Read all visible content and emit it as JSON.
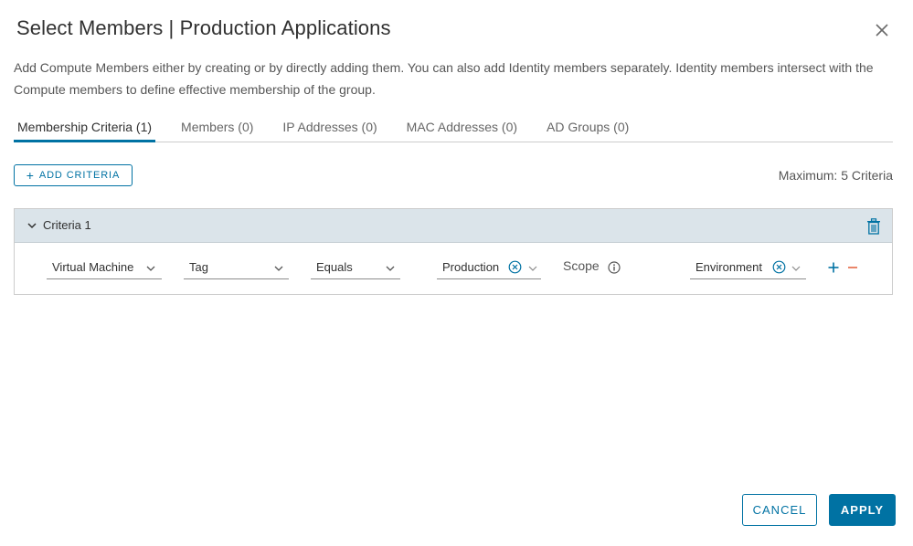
{
  "dialog": {
    "title": "Select Members | Production Applications",
    "description": "Add Compute Members either by creating or by directly adding them. You can also add Identity members separately. Identity members intersect with the Compute members to define effective membership of the group."
  },
  "tabs": [
    {
      "label": "Membership Criteria (1)",
      "active": true
    },
    {
      "label": "Members (0)",
      "active": false
    },
    {
      "label": "IP Addresses (0)",
      "active": false
    },
    {
      "label": "MAC Addresses (0)",
      "active": false
    },
    {
      "label": "AD Groups (0)",
      "active": false
    }
  ],
  "toolbar": {
    "add_criteria_label": "ADD CRITERIA",
    "max_text": "Maximum: 5 Criteria"
  },
  "criteria": {
    "title": "Criteria 1",
    "row": {
      "member_type": "Virtual Machine",
      "property": "Tag",
      "operator": "Equals",
      "tag_value": "Production",
      "scope_label": "Scope",
      "scope_value": "Environment"
    }
  },
  "footer": {
    "cancel_label": "CANCEL",
    "apply_label": "APPLY"
  },
  "colors": {
    "accent": "#0072a3",
    "criteria_header_bg": "#dbe4ea",
    "remove_red": "#e8785a"
  },
  "icons": {
    "close": "close-icon",
    "chevron": "chevron-down-icon",
    "trash": "trash-icon",
    "info": "info-icon",
    "clear": "clear-circle-icon",
    "add": "plus-icon",
    "remove": "minus-icon"
  }
}
